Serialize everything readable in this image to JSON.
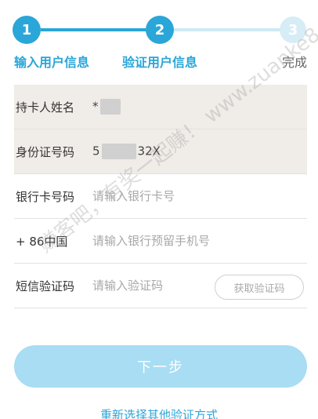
{
  "stepper": {
    "steps": [
      {
        "number": "1",
        "label": "输入用户信息"
      },
      {
        "number": "2",
        "label": "验证用户信息"
      },
      {
        "number": "3",
        "label": "完成"
      }
    ]
  },
  "form": {
    "cardholder": {
      "label": "持卡人姓名",
      "value_prefix": "*"
    },
    "id_number": {
      "label": "身份证号码",
      "value_prefix": "5",
      "value_suffix": "32X"
    },
    "bank_card": {
      "label": "银行卡号码",
      "placeholder": "请输入银行卡号"
    },
    "phone": {
      "label": "+ 86中国",
      "placeholder": "请输入银行预留手机号"
    },
    "sms": {
      "label": "短信验证码",
      "placeholder": "请输入验证码",
      "get_code_label": "获取验证码"
    }
  },
  "actions": {
    "next_label": "下一步",
    "alt_method_label": "重新选择其他验证方式"
  },
  "watermark": "赚客吧，有奖一起赚！ www.zuanke8.com"
}
